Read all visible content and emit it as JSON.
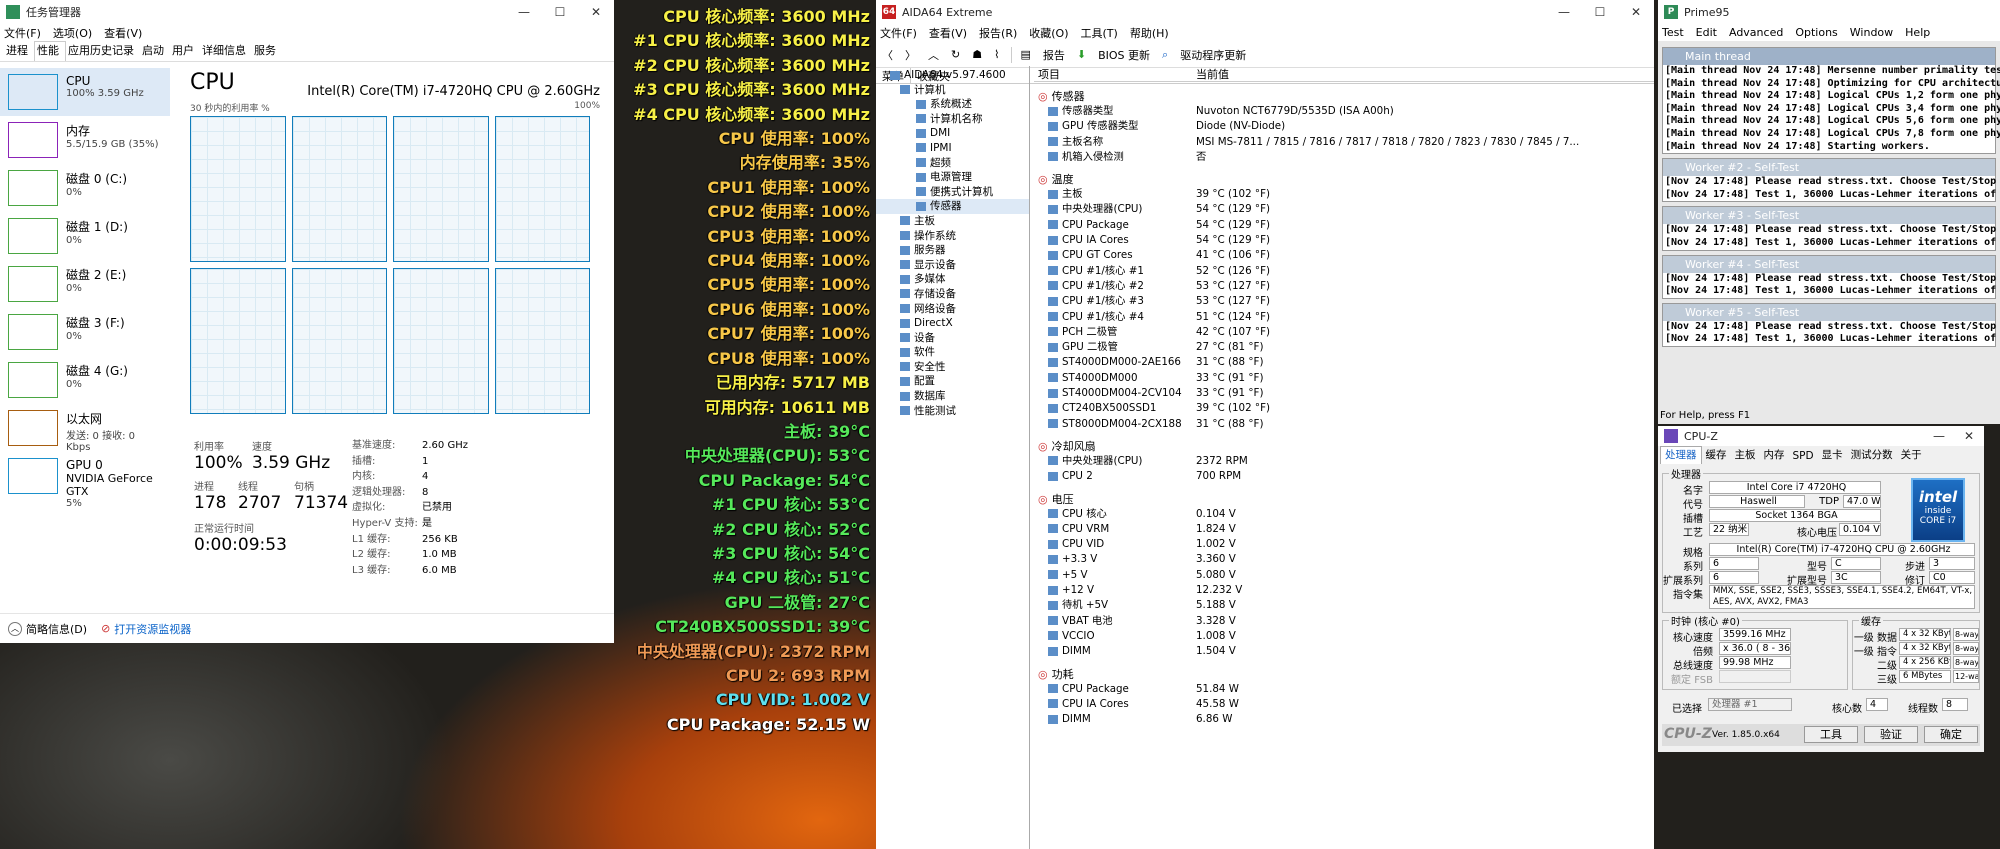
{
  "taskmgr": {
    "title": "任务管理器",
    "menus": [
      "文件(F)",
      "选项(O)",
      "查看(V)"
    ],
    "tabs": [
      "进程",
      "性能",
      "应用历史记录",
      "启动",
      "用户",
      "详细信息",
      "服务"
    ],
    "sidebar": [
      {
        "name": "CPU",
        "value": "100%  3.59 GHz"
      },
      {
        "name": "内存",
        "value": "5.5/15.9 GB (35%)"
      },
      {
        "name": "磁盘 0 (C:)",
        "value": "0%"
      },
      {
        "name": "磁盘 1 (D:)",
        "value": "0%"
      },
      {
        "name": "磁盘 2 (E:)",
        "value": "0%"
      },
      {
        "name": "磁盘 3 (F:)",
        "value": "0%"
      },
      {
        "name": "磁盘 4 (G:)",
        "value": "0%"
      },
      {
        "name": "以太网",
        "value": "发送: 0 接收: 0 Kbps"
      },
      {
        "name": "GPU 0",
        "value": "NVIDIA GeForce GTX",
        "value2": "5%"
      }
    ],
    "heading": "CPU",
    "model": "Intel(R) Core(TM) i7-4720HQ CPU @ 2.60GHz",
    "graph_label": "30 秒内的利用率 %",
    "graph_max": "100%",
    "util_label": "利用率",
    "util_value": "100%",
    "speed_label": "速度",
    "speed_value": "3.59 GHz",
    "proc_label": "进程",
    "proc_value": "178",
    "thread_label": "线程",
    "thread_value": "2707",
    "handle_label": "句柄",
    "handle_value": "71374",
    "uptime_label": "正常运行时间",
    "uptime_value": "0:00:09:53",
    "details": [
      {
        "k": "基准速度:",
        "v": "2.60 GHz"
      },
      {
        "k": "插槽:",
        "v": "1"
      },
      {
        "k": "内核:",
        "v": "4"
      },
      {
        "k": "逻辑处理器:",
        "v": "8"
      },
      {
        "k": "虚拟化:",
        "v": "已禁用"
      },
      {
        "k": "Hyper-V 支持:",
        "v": "是"
      },
      {
        "k": "L1 缓存:",
        "v": "256 KB"
      },
      {
        "k": "L2 缓存:",
        "v": "1.0 MB"
      },
      {
        "k": "L3 缓存:",
        "v": "6.0 MB"
      }
    ],
    "brief": "简略信息(D)",
    "resmon": "打开资源监视器"
  },
  "osd": [
    {
      "t": "CPU 核心频率: 3600 MHz",
      "c": "#f7f047"
    },
    {
      "t": "#1 CPU 核心频率: 3600 MHz",
      "c": "#f7f047"
    },
    {
      "t": "#2 CPU 核心频率: 3600 MHz",
      "c": "#f7f047"
    },
    {
      "t": "#3 CPU 核心频率: 3600 MHz",
      "c": "#f7f047"
    },
    {
      "t": "#4 CPU 核心频率: 3600 MHz",
      "c": "#f7f047"
    },
    {
      "t": "CPU 使用率: 100%",
      "c": "#f7c748"
    },
    {
      "t": "内存使用率: 35%",
      "c": "#f7c748"
    },
    {
      "t": "CPU1 使用率: 100%",
      "c": "#f7c748"
    },
    {
      "t": "CPU2 使用率: 100%",
      "c": "#f7c748"
    },
    {
      "t": "CPU3 使用率: 100%",
      "c": "#f7c748"
    },
    {
      "t": "CPU4 使用率: 100%",
      "c": "#f7c748"
    },
    {
      "t": "CPU5 使用率: 100%",
      "c": "#f7c748"
    },
    {
      "t": "CPU6 使用率: 100%",
      "c": "#f7c748"
    },
    {
      "t": "CPU7 使用率: 100%",
      "c": "#f7c748"
    },
    {
      "t": "CPU8 使用率: 100%",
      "c": "#f7c748"
    },
    {
      "t": "已用内存: 5717 MB",
      "c": "#f7f047"
    },
    {
      "t": "可用内存: 10611 MB",
      "c": "#f7f047"
    },
    {
      "t": "主板: 39°C",
      "c": "#56e85a"
    },
    {
      "t": "中央处理器(CPU): 53°C",
      "c": "#56e85a"
    },
    {
      "t": "CPU Package: 54°C",
      "c": "#56e85a"
    },
    {
      "t": "#1 CPU 核心: 53°C",
      "c": "#56e85a"
    },
    {
      "t": "#2 CPU 核心: 52°C",
      "c": "#56e85a"
    },
    {
      "t": "#3 CPU 核心: 54°C",
      "c": "#56e85a"
    },
    {
      "t": "#4 CPU 核心: 51°C",
      "c": "#56e85a"
    },
    {
      "t": "GPU 二极管: 27°C",
      "c": "#56e85a"
    },
    {
      "t": "CT240BX500SSD1: 39°C",
      "c": "#56e85a"
    },
    {
      "t": "中央处理器(CPU): 2372 RPM",
      "c": "#f09a55"
    },
    {
      "t": "CPU 2: 693 RPM",
      "c": "#f09a55"
    },
    {
      "t": "CPU VID: 1.002 V",
      "c": "#5ee0f0"
    },
    {
      "t": "CPU Package: 52.15 W",
      "c": "#ffffff"
    }
  ],
  "aida": {
    "title": "AIDA64 Extreme",
    "menus": [
      "文件(F)",
      "查看(V)",
      "报告(R)",
      "收藏(O)",
      "工具(T)",
      "帮助(H)"
    ],
    "toolbar": [
      "报告",
      "BIOS 更新",
      "驱动程序更新"
    ],
    "panel_tabs": [
      "菜单",
      "收藏夹"
    ],
    "tree": [
      "AIDA64 v5.97.4600",
      "计算机",
      "系统概述",
      "计算机名称",
      "DMI",
      "IPMI",
      "超频",
      "电源管理",
      "便携式计算机",
      "传感器",
      "主板",
      "操作系统",
      "服务器",
      "显示设备",
      "多媒体",
      "存储设备",
      "网络设备",
      "DirectX",
      "设备",
      "软件",
      "安全性",
      "配置",
      "数据库",
      "性能测试"
    ],
    "col_item": "项目",
    "col_value": "当前值",
    "sections": [
      {
        "title": "传感器",
        "rows": [
          [
            "传感器类型",
            "Nuvoton NCT6779D/5535D  (ISA A00h)"
          ],
          [
            "GPU 传感器类型",
            "Diode  (NV-Diode)"
          ],
          [
            "主板名称",
            "MSI MS-7811 / 7815 / 7816 / 7817 / 7818 / 7820 / 7823 / 7830 / 7845 / 7..."
          ],
          [
            "机箱入侵检测",
            "否"
          ]
        ]
      },
      {
        "title": "温度",
        "rows": [
          [
            "主板",
            "39 °C  (102 °F)"
          ],
          [
            "中央处理器(CPU)",
            "54 °C  (129 °F)"
          ],
          [
            "CPU Package",
            "54 °C  (129 °F)"
          ],
          [
            "CPU IA Cores",
            "54 °C  (129 °F)"
          ],
          [
            "CPU GT Cores",
            "41 °C  (106 °F)"
          ],
          [
            "CPU #1/核心 #1",
            "52 °C  (126 °F)"
          ],
          [
            "CPU #1/核心 #2",
            "53 °C  (127 °F)"
          ],
          [
            "CPU #1/核心 #3",
            "53 °C  (127 °F)"
          ],
          [
            "CPU #1/核心 #4",
            "51 °C  (124 °F)"
          ],
          [
            "PCH 二极管",
            "42 °C  (107 °F)"
          ],
          [
            "GPU 二极管",
            "27 °C  (81 °F)"
          ],
          [
            "ST4000DM000-2AE166",
            "31 °C  (88 °F)"
          ],
          [
            "ST4000DM000",
            "33 °C  (91 °F)"
          ],
          [
            "ST4000DM004-2CV104",
            "33 °C  (91 °F)"
          ],
          [
            "CT240BX500SSD1",
            "39 °C  (102 °F)"
          ],
          [
            "ST8000DM004-2CX188",
            "31 °C  (88 °F)"
          ]
        ]
      },
      {
        "title": "冷却风扇",
        "rows": [
          [
            "中央处理器(CPU)",
            "2372 RPM"
          ],
          [
            "CPU 2",
            "700 RPM"
          ]
        ]
      },
      {
        "title": "电压",
        "rows": [
          [
            "CPU 核心",
            "0.104 V"
          ],
          [
            "CPU VRM",
            "1.824 V"
          ],
          [
            "CPU VID",
            "1.002 V"
          ],
          [
            "+3.3 V",
            "3.360 V"
          ],
          [
            "+5 V",
            "5.080 V"
          ],
          [
            "+12 V",
            "12.232 V"
          ],
          [
            "待机 +5V",
            "5.188 V"
          ],
          [
            "VBAT 电池",
            "3.328 V"
          ],
          [
            "VCCIO",
            "1.008 V"
          ],
          [
            "DIMM",
            "1.504 V"
          ]
        ]
      },
      {
        "title": "功耗",
        "rows": [
          [
            "CPU Package",
            "51.84 W"
          ],
          [
            "CPU IA Cores",
            "45.58 W"
          ],
          [
            "DIMM",
            "6.86 W"
          ]
        ]
      }
    ]
  },
  "prime": {
    "title": "Prime95",
    "menus": [
      "Test",
      "Edit",
      "Advanced",
      "Options",
      "Window",
      "Help"
    ],
    "main_title": "Main thread",
    "main_lines": [
      "[Main thread Nov 24 17:48] Mersenne number primality test pro",
      "[Main thread Nov 24 17:48] Optimizing for CPU architecture: Cor",
      "[Main thread Nov 24 17:48] Logical CPUs 1,2 form one physical",
      "[Main thread Nov 24 17:48] Logical CPUs 3,4 form one physical",
      "[Main thread Nov 24 17:48] Logical CPUs 5,6 form one physical",
      "[Main thread Nov 24 17:48] Logical CPUs 7,8 form one physical",
      "[Main thread Nov 24 17:48] Starting workers."
    ],
    "workers": [
      {
        "title": "Worker #2 - Self-Test",
        "l1": "[Nov 24 17:48] Please read stress.txt.  Choose Test/Stop to end",
        "l2": "[Nov 24 17:48] Test 1, 36000 Lucas-Lehmer iterations of M8716"
      },
      {
        "title": "Worker #3 - Self-Test",
        "l1": "[Nov 24 17:48] Please read stress.txt.  Choose Test/Stop to end",
        "l2": "[Nov 24 17:48] Test 1, 36000 Lucas-Lehmer iterations of M8716"
      },
      {
        "title": "Worker #4 - Self-Test",
        "l1": "[Nov 24 17:48] Please read stress.txt.  Choose Test/Stop to end",
        "l2": "[Nov 24 17:48] Test 1, 36000 Lucas-Lehmer iterations of M8716"
      },
      {
        "title": "Worker #5 - Self-Test",
        "l1": "[Nov 24 17:48] Please read stress.txt.  Choose Test/Stop to end",
        "l2": "[Nov 24 17:48] Test 1, 36000 Lucas-Lehmer iterations of M8716"
      }
    ],
    "status": "For Help, press F1"
  },
  "cpuz": {
    "title": "CPU-Z",
    "tabs": [
      "处理器",
      "缓存",
      "主板",
      "内存",
      "SPD",
      "显卡",
      "测试分数",
      "关于"
    ],
    "proc_group": "处理器",
    "name_k": "名字",
    "name_v": "Intel Core i7 4720HQ",
    "code_k": "代号",
    "code_v": "Haswell",
    "tdp_k": "TDP",
    "tdp_v": "47.0 W",
    "socket_k": "插槽",
    "socket_v": "Socket 1364 BGA",
    "tech_k": "工艺",
    "tech_v": "22 纳米",
    "vcore_k": "核心电压",
    "vcore_v": "0.104 V",
    "spec_k": "规格",
    "spec_v": "Intel(R) Core(TM) i7-4720HQ CPU @ 2.60GHz",
    "family_k": "系列",
    "family_v": "6",
    "model_k": "型号",
    "model_v": "C",
    "step_k": "步进",
    "step_v": "3",
    "extfam_k": "扩展系列",
    "extfam_v": "6",
    "extmod_k": "扩展型号",
    "extmod_v": "3C",
    "rev_k": "修订",
    "rev_v": "C0",
    "instr_k": "指令集",
    "instr_v": "MMX, SSE, SSE2, SSE3, SSSE3, SSE4.1, SSE4.2, EM64T, VT-x, AES, AVX, AVX2, FMA3",
    "clock_group": "时钟 (核心 #0)",
    "corespd_k": "核心速度",
    "corespd_v": "3599.16 MHz",
    "mult_k": "倍频",
    "mult_v": "x 36.0 ( 8 - 36 )",
    "bus_k": "总线速度",
    "bus_v": "99.98 MHz",
    "fsb_k": "额定 FSB",
    "cache_group": "缓存",
    "cache": [
      {
        "k": "一级 数据",
        "v": "4 x 32 KBytes",
        "w": "8-way"
      },
      {
        "k": "一级 指令",
        "v": "4 x 32 KBytes",
        "w": "8-way"
      },
      {
        "k": "二级",
        "v": "4 x 256 KBytes",
        "w": "8-way"
      },
      {
        "k": "三级",
        "v": "6 MBytes",
        "w": "12-way"
      }
    ],
    "sel_k": "已选择",
    "sel_v": "处理器 #1",
    "cores_k": "核心数",
    "cores_v": "4",
    "threads_k": "线程数",
    "threads_v": "8",
    "brand": "CPU-Z",
    "version": "Ver. 1.85.0.x64",
    "tools": "工具",
    "validate": "验证",
    "ok": "确定",
    "logo_line1": "intel",
    "logo_line2": "inside",
    "logo_line3": "CORE i7"
  }
}
